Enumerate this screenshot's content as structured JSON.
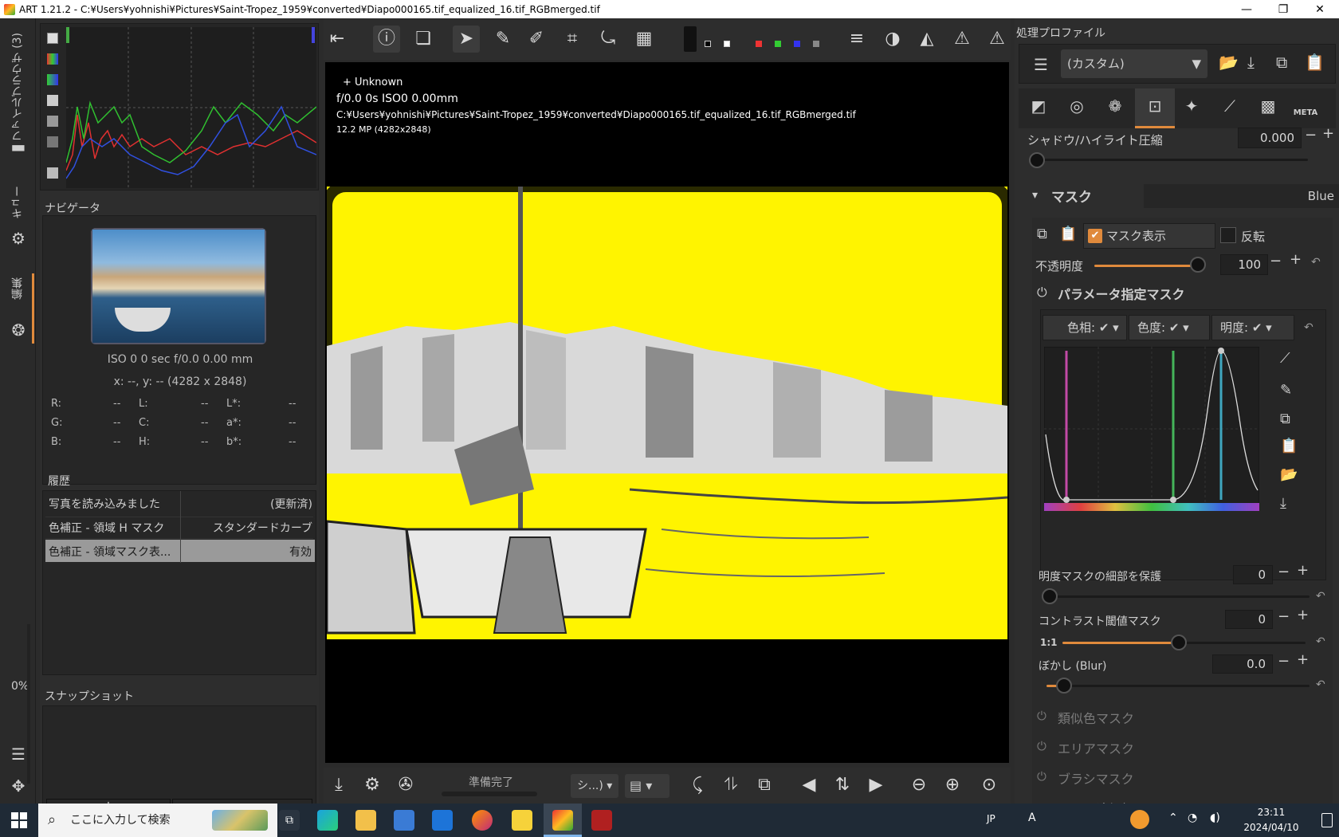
{
  "window": {
    "title": "ART 1.21.2 - C:¥Users¥yohnishi¥Pictures¥Saint-Tropez_1959¥converted¥Diapo000165.tif_equalized_16.tif_RGBmerged.tif",
    "min": "—",
    "max": "❐",
    "close": "✕"
  },
  "left_strip": {
    "file_browser": "ファイルブラウザ (3)",
    "queue": "キュー",
    "edit": "編集",
    "zoom_pct": "0%"
  },
  "navigator": {
    "title": "ナビゲータ",
    "exif": "ISO 0    0 sec    f/0.0    0.00 mm",
    "coords": "x: --, y: --    (4282 x 2848)",
    "r_label": "R:",
    "g_label": "G:",
    "b_label": "B:",
    "l_label": "L:",
    "c_label": "C:",
    "h_label": "H:",
    "lstar_label": "L*:",
    "astar_label": "a*:",
    "bstar_label": "b*:",
    "dash": "--"
  },
  "history": {
    "title": "履歴",
    "rows": [
      {
        "action": "写真を読み込みました",
        "value": "(更新済)"
      },
      {
        "action": "色補正 - 領域 H マスク",
        "value": "スタンダードカーブ"
      },
      {
        "action": "色補正 - 領域マスク表...",
        "value": "有効"
      }
    ]
  },
  "snapshot": {
    "title": "スナップショット",
    "add": "+",
    "remove": "−"
  },
  "viewer_info": {
    "lens": "+ Unknown",
    "exposure_line": "f/0.0  0s  ISO0  0.00mm",
    "path": "C:¥Users¥yohnishi¥Pictures¥Saint-Tropez_1959¥converted¥Diapo000165.tif_equalized_16.tif_RGBmerged.tif",
    "size": "12.2 MP (4282x2848)"
  },
  "bottom_bar": {
    "status": "準備完了",
    "combo": "シ...)"
  },
  "right_panel": {
    "profile_title": "処理プロファイル",
    "profile_value": "(カスタム)",
    "shadow_label": "シャドウ/ハイライト圧縮",
    "shadow_value": "0.000",
    "mask_title": "マスク",
    "mask_channel": "Blue",
    "mask_show": "マスク表示",
    "invert": "反転",
    "opacity_label": "不透明度",
    "opacity_value": "100",
    "param_mask_title": "パラメータ指定マスク",
    "hue_tab": "色相:",
    "chroma_tab": "色度:",
    "light_tab": "明度:",
    "detail_label": "明度マスクの細部を保護",
    "detail_value": "0",
    "contrast_label": "コントラスト閾値マスク",
    "contrast_value": "0",
    "contrast_ratio": "1:1",
    "blur_label": "ぼかし (Blur)",
    "blur_value": "0.0",
    "similar_mask": "類似色マスク",
    "area_mask": "エリアマスク",
    "brush_mask": "ブラシマスク",
    "post_processing": "マスク追加処理 (Post Processing)",
    "meta_tab": "META"
  },
  "taskbar": {
    "search_placeholder": "ここに入力して検索",
    "lang": "JP",
    "ime": "A",
    "time": "23:11",
    "date": "2024/04/10"
  },
  "colors": {
    "accent": "#e08a3c",
    "mask_yellow": "#fff400",
    "curve_magenta": "#c24aa6",
    "curve_green": "#45b45a",
    "curve_cyan": "#3fa7c0"
  }
}
